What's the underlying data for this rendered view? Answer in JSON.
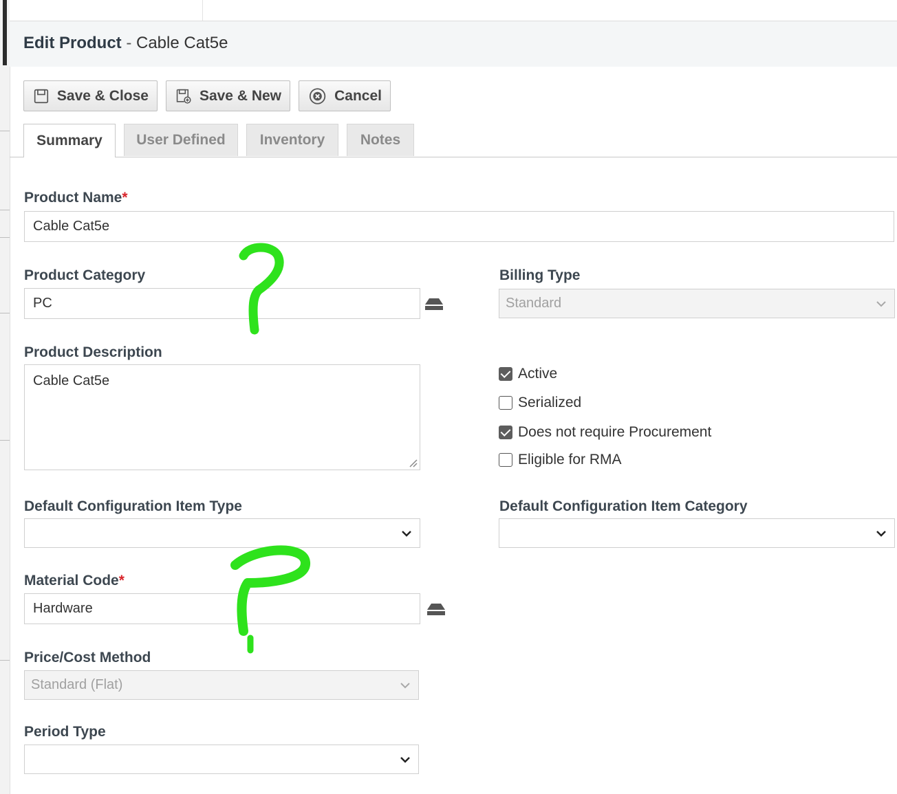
{
  "header": {
    "title_bold": "Edit Product",
    "title_separator": " - ",
    "title_name": "Cable Cat5e"
  },
  "toolbar": {
    "save_close_label": "Save & Close",
    "save_new_label": "Save & New",
    "cancel_label": "Cancel"
  },
  "tabs": [
    {
      "label": "Summary",
      "active": true
    },
    {
      "label": "User Defined",
      "active": false
    },
    {
      "label": "Inventory",
      "active": false
    },
    {
      "label": "Notes",
      "active": false
    }
  ],
  "form": {
    "required_marker": "*",
    "product_name": {
      "label": "Product Name",
      "value": "Cable Cat5e"
    },
    "product_category": {
      "label": "Product Category",
      "value": "PC"
    },
    "billing_type": {
      "label": "Billing Type",
      "value": "Standard",
      "disabled": true
    },
    "product_description": {
      "label": "Product Description",
      "value": "Cable Cat5e"
    },
    "checkboxes": [
      {
        "label": "Active",
        "checked": true
      },
      {
        "label": "Serialized",
        "checked": false
      },
      {
        "label": "Does not require Procurement",
        "checked": true
      },
      {
        "label": "Eligible for RMA",
        "checked": false
      }
    ],
    "default_ci_type": {
      "label": "Default Configuration Item Type",
      "value": ""
    },
    "default_ci_category": {
      "label": "Default Configuration Item Category",
      "value": ""
    },
    "material_code": {
      "label": "Material Code",
      "value": "Hardware"
    },
    "price_cost_method": {
      "label": "Price/Cost Method",
      "value": "Standard (Flat)",
      "disabled": true
    },
    "period_type": {
      "label": "Period Type",
      "value": ""
    }
  },
  "annotations": {
    "color": "#2ee21c",
    "marks": [
      "question-mark",
      "question-mark"
    ]
  },
  "icons": {
    "save_close": "floppy-disk-icon",
    "save_new": "floppy-plus-icon",
    "cancel": "circle-x-icon",
    "lookup": "lookup-stack-icon",
    "dropdown": "chevron-down-icon"
  }
}
